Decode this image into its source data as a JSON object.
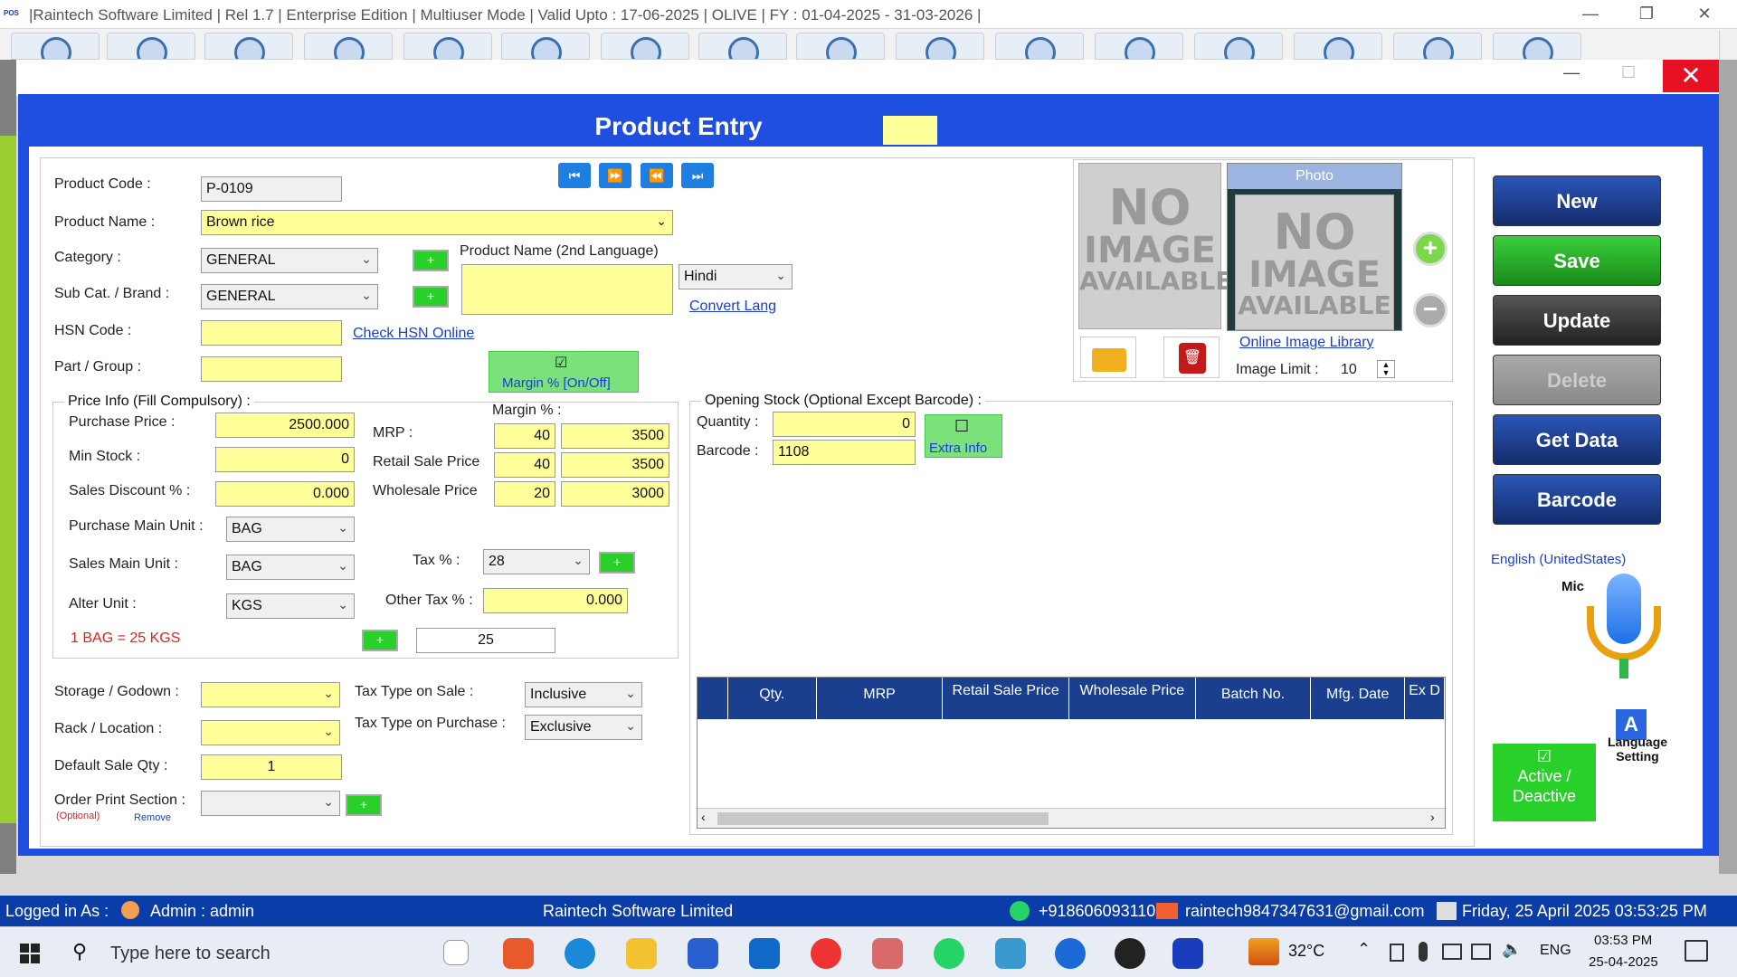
{
  "titlebar": {
    "logo": "POS",
    "title": "|Raintech Software Limited | Rel 1.7 | Enterprise Edition | Multiuser Mode | Valid Upto : 17-06-2025 | OLIVE | FY : 01-04-2025 - 31-03-2026 |",
    "minimize": "—",
    "restore": "❐",
    "close": "✕"
  },
  "dialog": {
    "title": "Product Entry",
    "close": "✕",
    "minimize": "—",
    "maximize": "☐"
  },
  "form": {
    "product_code_label": "Product Code :",
    "product_code": "P-0109",
    "product_name_label": "Product Name :",
    "product_name": "Brown rice",
    "category_label": "Category :",
    "category": "GENERAL",
    "subcat_label": "Sub Cat. / Brand :",
    "subcat": "GENERAL",
    "hsn_label": "HSN Code :",
    "hsn": "",
    "check_hsn": "Check HSN Online",
    "part_label": "Part / Group :",
    "part": "",
    "name2_label": "Product Name (2nd Language)",
    "language": "Hindi",
    "convert_lang": "Convert Lang",
    "margin_toggle": "Margin % [On/Off]",
    "plus": "+"
  },
  "price": {
    "group_title": "Price Info (Fill Compulsory) :",
    "purchase_label": "Purchase Price :",
    "purchase": "2500.000",
    "minstock_label": "Min Stock :",
    "minstock": "0",
    "discount_label": "Sales Discount % :",
    "discount": "0.000",
    "margin_label": "Margin % :",
    "mrp_label": "MRP :",
    "mrp_margin": "40",
    "mrp": "3500",
    "retail_label": "Retail Sale Price",
    "retail_margin": "40",
    "retail": "3500",
    "wholesale_label": "Wholesale Price",
    "wholesale_margin": "20",
    "wholesale": "3000",
    "pmu_label": "Purchase Main Unit :",
    "pmu": "BAG",
    "smu_label": "Sales Main Unit :",
    "smu": "BAG",
    "alter_label": "Alter Unit :",
    "alter": "KGS",
    "tax_label": "Tax % :",
    "tax": "28",
    "other_tax_label": "Other Tax % :",
    "other_tax": "0.000",
    "conversion_text": "1 BAG = 25 KGS",
    "conversion": "25"
  },
  "lower": {
    "storage_label": "Storage / Godown :",
    "rack_label": "Rack / Location :",
    "default_qty_label": "Default Sale Qty :",
    "default_qty": "1",
    "order_print_label": "Order Print Section :",
    "optional": "(Optional)",
    "remove": "Remove",
    "tax_sale_label": "Tax Type on Sale :",
    "tax_sale": "Inclusive",
    "tax_purchase_label": "Tax Type on Purchase :",
    "tax_purchase": "Exclusive"
  },
  "stock": {
    "group_title": "Opening Stock (Optional Except Barcode) :",
    "qty_label": "Quantity :",
    "qty": "0",
    "barcode_label": "Barcode :",
    "barcode": "1108",
    "extra_info": "Extra Info",
    "columns": [
      "Qty.",
      "MRP",
      "Retail Sale Price",
      "Wholesale Price",
      "Batch No.",
      "Mfg. Date",
      "Ex D"
    ]
  },
  "images": {
    "no_image_text": [
      "NO",
      "IMAGE",
      "AVAILABLE"
    ],
    "photo_label": "Photo",
    "online_library": "Online Image Library",
    "image_limit_label": "Image Limit :",
    "image_limit": "10"
  },
  "buttons": {
    "new": "New",
    "save": "Save",
    "update": "Update",
    "delete": "Delete",
    "get_data": "Get Data",
    "barcode": "Barcode",
    "language_current": "English (UnitedStates)",
    "mic": "Mic",
    "language_setting": "Language Setting",
    "active_deactive": "Active / Deactive"
  },
  "status": {
    "logged_in": "Logged in As :",
    "user": "Admin  :  admin",
    "company": "Raintech Software Limited",
    "phone": "+918606093110",
    "email": "raintech9847347631@gmail.com",
    "datetime": "Friday, 25 April 2025 03:53:25 PM"
  },
  "taskbar": {
    "search_placeholder": "Type here to search",
    "temperature": "32°C",
    "lang": "ENG",
    "time": "03:53 PM",
    "date": "25-04-2025"
  },
  "colors": {
    "dialog_blue": "#1e4fe0",
    "field_yellow": "#ffff99",
    "status_blue": "#0a3da8",
    "close_red": "#e81123"
  }
}
